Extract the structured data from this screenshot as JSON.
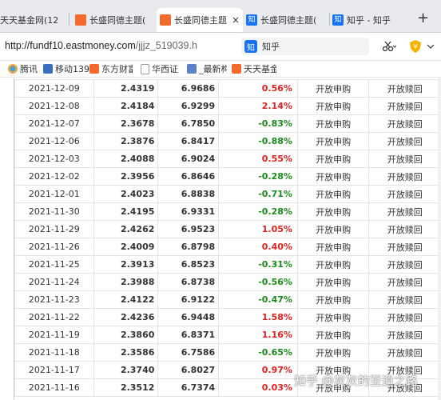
{
  "tabs": [
    {
      "title": "天天基金网(12",
      "icon_color": "#c8a238"
    },
    {
      "title": "长盛同德主题(",
      "icon_color": "#f26a2e"
    },
    {
      "title": "长盛同德主题(",
      "icon_color": "#f26a2e",
      "close": "×"
    },
    {
      "title": "长盛同德主题(",
      "icon_color": "#1772f6",
      "icon_text": "知"
    },
    {
      "title": "知乎 - 知乎",
      "icon_color": "#1772f6",
      "icon_text": "知"
    }
  ],
  "new_tab": "+",
  "address": {
    "host": "http://fundf10.eastmoney.com",
    "path": "/jjjz_519039.h"
  },
  "search": {
    "badge": "知",
    "text": "知乎"
  },
  "bookmarks": [
    "腾讯",
    "移动139",
    "东方财富",
    "华西证",
    "_最新构",
    "天天基金"
  ],
  "table": {
    "rows": [
      {
        "date": "2021-12-09",
        "nav": "2.4319",
        "acc": "6.9686",
        "pct": "0.56%",
        "dir": "up",
        "buy": "开放申购",
        "redeem": "开放赎回"
      },
      {
        "date": "2021-12-08",
        "nav": "2.4184",
        "acc": "6.9299",
        "pct": "2.14%",
        "dir": "up",
        "buy": "开放申购",
        "redeem": "开放赎回"
      },
      {
        "date": "2021-12-07",
        "nav": "2.3678",
        "acc": "6.7850",
        "pct": "-0.83%",
        "dir": "down",
        "buy": "开放申购",
        "redeem": "开放赎回"
      },
      {
        "date": "2021-12-06",
        "nav": "2.3876",
        "acc": "6.8417",
        "pct": "-0.88%",
        "dir": "down",
        "buy": "开放申购",
        "redeem": "开放赎回"
      },
      {
        "date": "2021-12-03",
        "nav": "2.4088",
        "acc": "6.9024",
        "pct": "0.55%",
        "dir": "up",
        "buy": "开放申购",
        "redeem": "开放赎回"
      },
      {
        "date": "2021-12-02",
        "nav": "2.3956",
        "acc": "6.8646",
        "pct": "-0.28%",
        "dir": "down",
        "buy": "开放申购",
        "redeem": "开放赎回"
      },
      {
        "date": "2021-12-01",
        "nav": "2.4023",
        "acc": "6.8838",
        "pct": "-0.71%",
        "dir": "down",
        "buy": "开放申购",
        "redeem": "开放赎回"
      },
      {
        "date": "2021-11-30",
        "nav": "2.4195",
        "acc": "6.9331",
        "pct": "-0.28%",
        "dir": "down",
        "buy": "开放申购",
        "redeem": "开放赎回"
      },
      {
        "date": "2021-11-29",
        "nav": "2.4262",
        "acc": "6.9523",
        "pct": "1.05%",
        "dir": "up",
        "buy": "开放申购",
        "redeem": "开放赎回"
      },
      {
        "date": "2021-11-26",
        "nav": "2.4009",
        "acc": "6.8798",
        "pct": "0.40%",
        "dir": "up",
        "buy": "开放申购",
        "redeem": "开放赎回"
      },
      {
        "date": "2021-11-25",
        "nav": "2.3913",
        "acc": "6.8523",
        "pct": "-0.31%",
        "dir": "down",
        "buy": "开放申购",
        "redeem": "开放赎回"
      },
      {
        "date": "2021-11-24",
        "nav": "2.3988",
        "acc": "6.8738",
        "pct": "-0.56%",
        "dir": "down",
        "buy": "开放申购",
        "redeem": "开放赎回"
      },
      {
        "date": "2021-11-23",
        "nav": "2.4122",
        "acc": "6.9122",
        "pct": "-0.47%",
        "dir": "down",
        "buy": "开放申购",
        "redeem": "开放赎回"
      },
      {
        "date": "2021-11-22",
        "nav": "2.4236",
        "acc": "6.9448",
        "pct": "1.58%",
        "dir": "up",
        "buy": "开放申购",
        "redeem": "开放赎回"
      },
      {
        "date": "2021-11-19",
        "nav": "2.3860",
        "acc": "6.8371",
        "pct": "1.16%",
        "dir": "up",
        "buy": "开放申购",
        "redeem": "开放赎回"
      },
      {
        "date": "2021-11-18",
        "nav": "2.3586",
        "acc": "6.7586",
        "pct": "-0.65%",
        "dir": "down",
        "buy": "开放申购",
        "redeem": "开放赎回"
      },
      {
        "date": "2021-11-17",
        "nav": "2.3740",
        "acc": "6.8027",
        "pct": "0.97%",
        "dir": "up",
        "buy": "开放申购",
        "redeem": "开放赎回"
      },
      {
        "date": "2021-11-16",
        "nav": "2.3512",
        "acc": "6.7374",
        "pct": "0.03%",
        "dir": "up",
        "buy": "开放申购",
        "redeem": "开放赎回"
      }
    ]
  },
  "colors": {
    "up": "#e0211f",
    "down": "#1a8a1a"
  },
  "watermark": "知乎 @灰灰的至逍之路"
}
